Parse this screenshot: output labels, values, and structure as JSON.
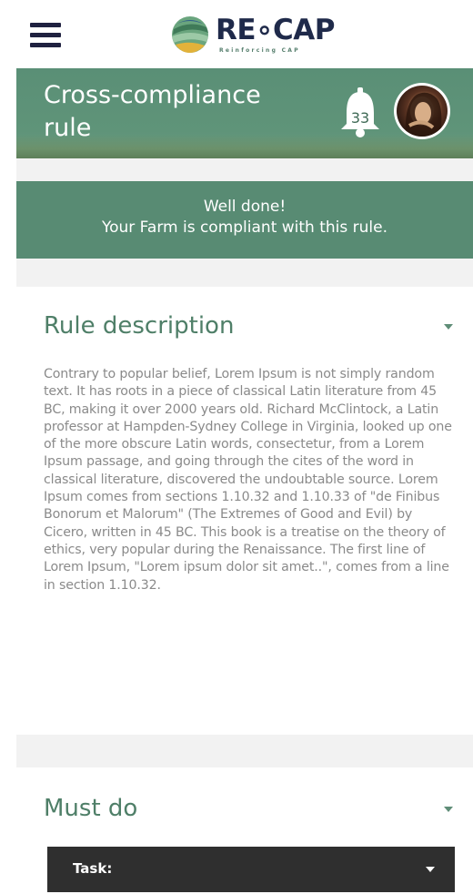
{
  "app": {
    "logo_text": "RE∘CAP",
    "logo_subtitle": "Reinforcing CAP"
  },
  "header": {
    "title": "Cross-compliance rule",
    "notification_count": "33"
  },
  "banner": {
    "line1": "Well done!",
    "line2": "Your Farm is compliant with this rule."
  },
  "rule_description": {
    "title": "Rule description",
    "text": "Contrary to popular belief, Lorem Ipsum is not simply random text. It has roots in a piece of classical Latin literature from 45 BC, making it over 2000 years old. Richard McClintock, a Latin professor at Hampden-Sydney College in Virginia, looked up one of the more obscure Latin words, consectetur, from a Lorem Ipsum passage, and going through the cites of the word in classical literature, discovered the undoubtable source. Lorem Ipsum comes from sections 1.10.32 and 1.10.33 of \"de Finibus Bonorum et Malorum\" (The Extremes of Good and Evil) by Cicero, written in 45 BC. This book is a treatise on the theory of ethics, very popular during the Renaissance. The first line of Lorem Ipsum, \"Lorem ipsum dolor sit amet..\", comes from a line in section 1.10.32."
  },
  "must_do": {
    "title": "Must do",
    "task_label": "Task:"
  },
  "colors": {
    "brand_green": "#588b73",
    "title_green": "#4f7f68",
    "navy": "#1f2140",
    "dark_dropdown": "#2f2f2f"
  },
  "icons": {
    "menu": "hamburger-icon",
    "logo": "recap-logo-icon",
    "notifications": "bell-icon",
    "profile": "avatar"
  }
}
